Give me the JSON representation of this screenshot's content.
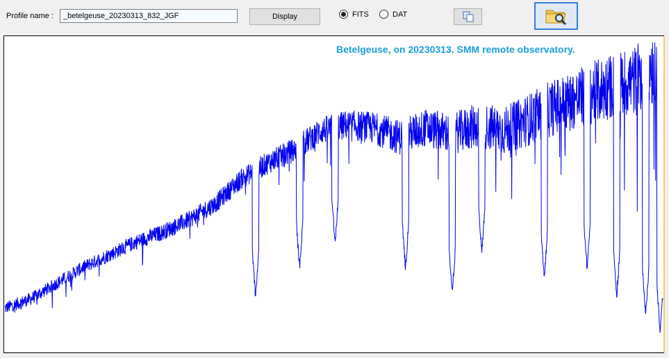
{
  "toolbar": {
    "profile_label": "Profile name :",
    "profile_value": "_betelgeuse_20230313_832_JGF",
    "display_button": "Display",
    "format_options": [
      {
        "label": "FITS",
        "selected": true
      },
      {
        "label": "DAT",
        "selected": false
      }
    ],
    "copy_icon": "copy-icon",
    "open_icon": "folder-search-icon"
  },
  "chart_data": {
    "type": "line",
    "title": "Betelgeuse, on 20230313. SMM  remote observatory.",
    "xlabel": "",
    "ylabel": "",
    "grid": false,
    "series": [
      {
        "color": "#0000ee",
        "x": [
          0,
          4,
          8,
          12,
          16,
          20,
          24,
          28,
          32,
          36,
          40,
          44,
          48,
          52,
          56,
          60,
          64,
          68,
          72,
          76,
          80,
          84,
          88,
          92,
          96,
          100
        ],
        "y": [
          0.14,
          0.17,
          0.22,
          0.27,
          0.31,
          0.35,
          0.38,
          0.42,
          0.47,
          0.55,
          0.6,
          0.64,
          0.7,
          0.72,
          0.71,
          0.68,
          0.71,
          0.69,
          0.72,
          0.7,
          0.74,
          0.78,
          0.81,
          0.84,
          0.86,
          0.92
        ],
        "dips": [
          {
            "x": 38.1,
            "y": 0.16
          },
          {
            "x": 44.8,
            "y": 0.25
          },
          {
            "x": 50.2,
            "y": 0.33
          },
          {
            "x": 60.9,
            "y": 0.25
          },
          {
            "x": 68.0,
            "y": 0.17
          },
          {
            "x": 72.5,
            "y": 0.3
          },
          {
            "x": 82.0,
            "y": 0.22
          },
          {
            "x": 88.5,
            "y": 0.25
          },
          {
            "x": 93.0,
            "y": 0.16
          },
          {
            "x": 97.4,
            "y": 0.1
          },
          {
            "x": 99.6,
            "y": 0.05
          }
        ]
      }
    ]
  }
}
